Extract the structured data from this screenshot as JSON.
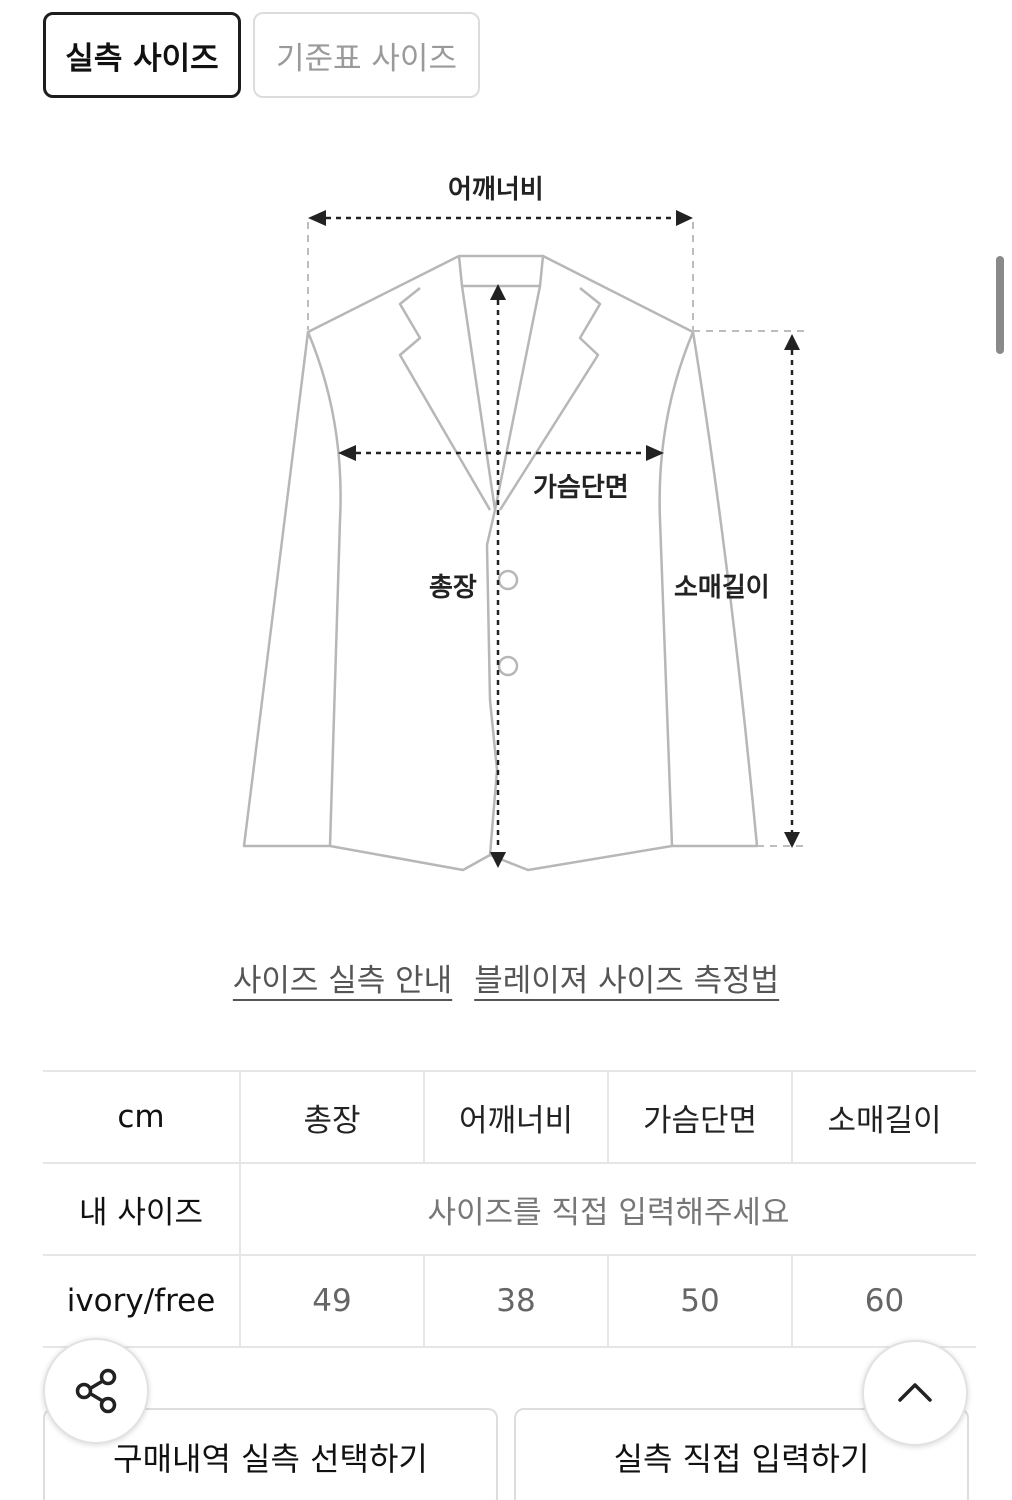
{
  "tabs": {
    "measured": "실측 사이즈",
    "standard": "기준표 사이즈"
  },
  "diagram": {
    "shoulder": "어깨너비",
    "chest": "가슴단면",
    "length": "총장",
    "sleeve": "소매길이"
  },
  "links": {
    "guide": "사이즈 실측 안내",
    "method": "블레이져 사이즈 측정법"
  },
  "table": {
    "unit": "cm",
    "columns": [
      "총장",
      "어깨너비",
      "가슴단면",
      "소매길이"
    ],
    "my_size_label": "내 사이즈",
    "my_size_placeholder": "사이즈를 직접 입력해주세요",
    "rows": [
      {
        "label": "ivory/free",
        "values": [
          "49",
          "38",
          "50",
          "60"
        ]
      }
    ]
  },
  "buttons": {
    "select_purchase": "구매내역 실측 선택하기",
    "direct_input": "실측 직접 입력하기"
  },
  "icons": {
    "share": "share-icon",
    "scroll_top": "chevron-up-icon"
  }
}
